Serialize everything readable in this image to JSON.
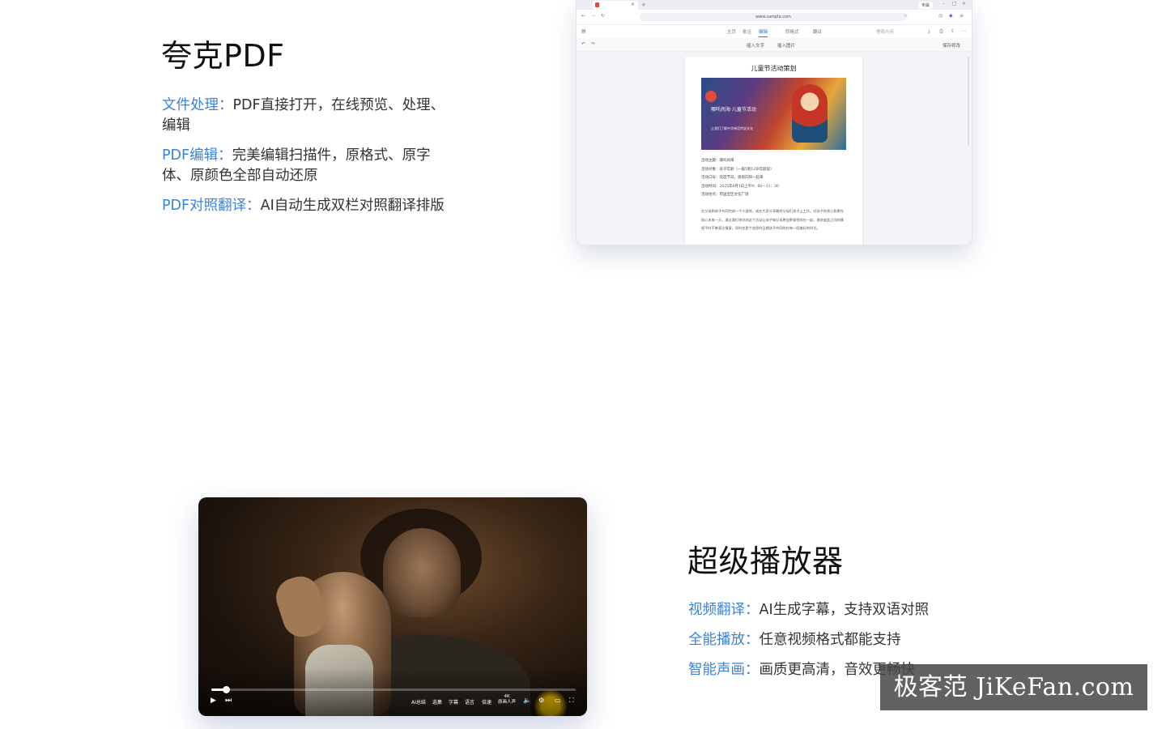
{
  "pdf_section": {
    "title": "夸克PDF",
    "features": [
      {
        "label": "文件处理：",
        "text": "PDF直接打开，在线预览、处理、",
        "text2": "编辑"
      },
      {
        "label": "PDF编辑：",
        "text": "完美编辑扫描件，原格式、原字",
        "text2": "体、原颜色全部自动还原"
      },
      {
        "label": "PDF对照翻译：",
        "text": "AI自动生成双栏对照翻译排版"
      }
    ]
  },
  "browser": {
    "url": "www.sample.com",
    "badge": "专属",
    "toolbar": [
      "主页",
      "批注",
      "编辑",
      "转格式",
      "翻译"
    ],
    "active_tool": "编辑",
    "search_placeholder": "搜索内容",
    "sub_toolbar": [
      "插入文字",
      "插入图片"
    ],
    "save_label": "保存修改",
    "doc": {
      "title": "儿童节活动策划",
      "poster_title": "哪吒闹海·儿童节活动",
      "poster_sub": "让我们了解中华神话传说文化",
      "lines": [
        "活动主题：哪吒闹海",
        "活动对象：孩子年龄（一般5到12岁年龄段）",
        "活动口号：欢度节日，感恩向阳一起来",
        "活动时间：2025年6月1日上午9：00—11：30",
        "活动地点：市国宝区文化广场"
      ],
      "paragraph": "在父母和孩子共同完成一个小游戏，或在大家分享最终父母们孩子上工作。对孩子的关心和更在耐心未来一天，通过我们举办的这个活动让孩子每父母更加更紧密的在一起，增进彼此之间的情感平时不善表达情意，同时也是个追思的日期孩子共同的在每一段美好的时光。"
    }
  },
  "player_section": {
    "title": "超级播放器",
    "features": [
      {
        "label": "视频翻译：",
        "text": "AI生成字幕，支持双语对照"
      },
      {
        "label": "全能播放：",
        "text": "任意视频格式都能支持"
      },
      {
        "label": "智能声画：",
        "text": "画质更高清，音效更畅快"
      }
    ]
  },
  "player": {
    "progress": 0.04,
    "controls": [
      "AI总结",
      "选集",
      "字幕",
      "语言",
      "倍速"
    ],
    "quality": "4K",
    "quality_sub": "原画人声"
  },
  "watermark": "极客范 JiKeFan.com"
}
